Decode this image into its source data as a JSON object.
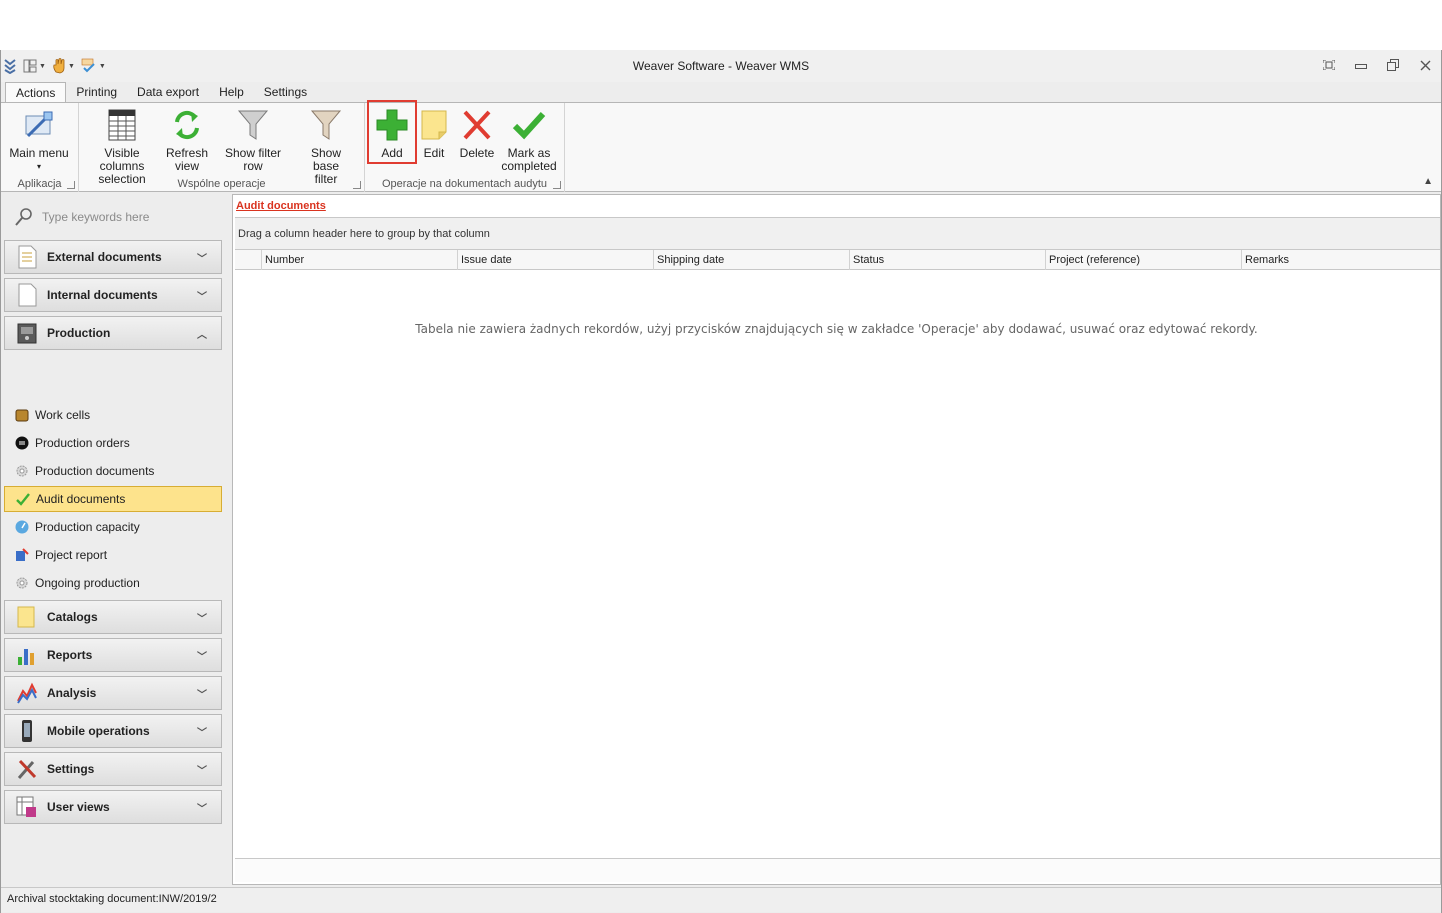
{
  "window": {
    "title": "Weaver Software - Weaver WMS"
  },
  "quick_access": [
    {
      "icon": "menu-chevron-icon"
    },
    {
      "icon": "layout-icon"
    },
    {
      "icon": "hand-icon"
    },
    {
      "icon": "spellcheck-icon"
    }
  ],
  "tabs": [
    {
      "label": "Actions",
      "active": true
    },
    {
      "label": "Printing"
    },
    {
      "label": "Data export"
    },
    {
      "label": "Help"
    },
    {
      "label": "Settings"
    }
  ],
  "ribbon": {
    "groups": [
      {
        "label": "Aplikacja",
        "buttons": [
          {
            "label": "Main menu",
            "sub": "▾",
            "icon": "main-menu-icon"
          }
        ]
      },
      {
        "label": "Wspólne operacje",
        "buttons": [
          {
            "label": "Visible columns",
            "label2": "selection",
            "icon": "columns-table-icon"
          },
          {
            "label": "Refresh",
            "label2": "view",
            "icon": "refresh-icon"
          },
          {
            "label": "Show filter row",
            "icon": "filter-icon"
          },
          {
            "label": "Show base",
            "label2": "filter",
            "icon": "base-filter-icon"
          }
        ]
      },
      {
        "label": "Operacje na dokumentach audytu",
        "buttons": [
          {
            "label": "Add",
            "icon": "add-plus-icon"
          },
          {
            "label": "Edit",
            "icon": "edit-note-icon"
          },
          {
            "label": "Delete",
            "icon": "delete-x-icon"
          },
          {
            "label": "Mark as",
            "label2": "completed",
            "icon": "checkmark-icon"
          }
        ]
      }
    ]
  },
  "sidebar": {
    "search_placeholder": "Type keywords here",
    "groups": [
      {
        "label": "External documents",
        "expanded": false
      },
      {
        "label": "Internal documents",
        "expanded": false
      },
      {
        "label": "Production",
        "expanded": true
      }
    ],
    "production_items": [
      {
        "label": "Work cells"
      },
      {
        "label": "Production orders"
      },
      {
        "label": "Production documents"
      },
      {
        "label": "Audit documents",
        "selected": true
      },
      {
        "label": "Production capacity"
      },
      {
        "label": "Project report"
      },
      {
        "label": "Ongoing production"
      }
    ],
    "groups_after": [
      {
        "label": "Catalogs"
      },
      {
        "label": "Reports"
      },
      {
        "label": "Analysis"
      },
      {
        "label": "Mobile operations"
      },
      {
        "label": "Settings"
      },
      {
        "label": "User views"
      }
    ]
  },
  "main": {
    "breadcrumb": "Audit documents",
    "group_panel_text": "Drag a column header here to group by that column",
    "columns": [
      "Number",
      "Issue date",
      "Shipping date",
      "Status",
      "Project (reference)",
      "Remarks"
    ],
    "empty_message": "Tabela nie zawiera żadnych rekordów, użyj przycisków znajdujących się w zakładce 'Operacje' aby dodawać, usuwać oraz edytować rekordy."
  },
  "status_bar": {
    "text": "Archival stocktaking document:INW/2019/2"
  },
  "colors": {
    "accent_red": "#d9331f",
    "selected_item": "#fde38c",
    "add_green": "#3cb035"
  }
}
